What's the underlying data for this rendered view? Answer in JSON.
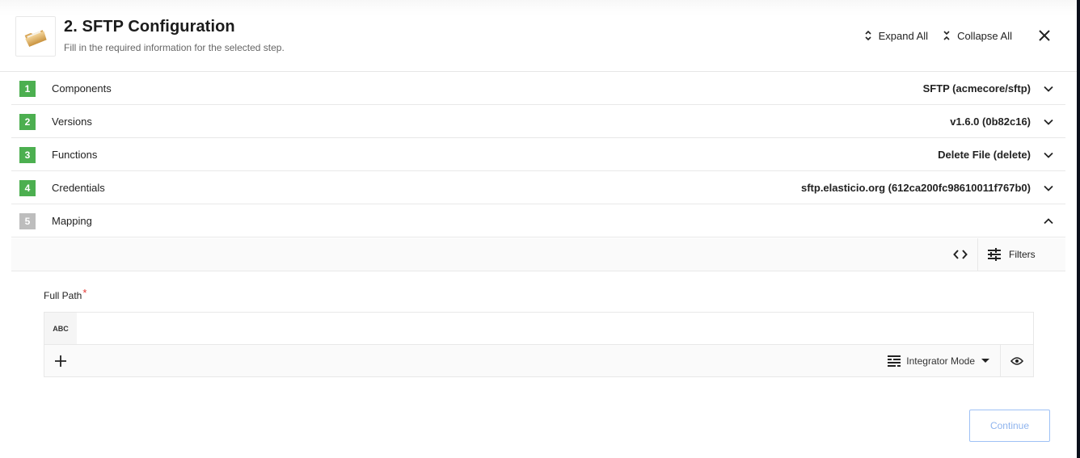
{
  "header": {
    "title": "2. SFTP Configuration",
    "subtitle": "Fill in the required information for the selected step.",
    "logo_icon": "folder-icon",
    "expand_all_label": "Expand All",
    "collapse_all_label": "Collapse All",
    "close_icon": "close-icon"
  },
  "steps": [
    {
      "number": "1",
      "label": "Components",
      "value": "SFTP (acmecore/sftp)",
      "status": "complete",
      "expanded": false
    },
    {
      "number": "2",
      "label": "Versions",
      "value": "v1.6.0 (0b82c16)",
      "status": "complete",
      "expanded": false
    },
    {
      "number": "3",
      "label": "Functions",
      "value": "Delete File (delete)",
      "status": "complete",
      "expanded": false
    },
    {
      "number": "4",
      "label": "Credentials",
      "value": "sftp.elasticio.org (612ca200fc98610011f767b0)",
      "status": "complete",
      "expanded": false
    },
    {
      "number": "5",
      "label": "Mapping",
      "value": "",
      "status": "pending",
      "expanded": true
    }
  ],
  "mapping": {
    "filters_label": "Filters",
    "field": {
      "label": "Full Path",
      "required_marker": "*",
      "type_badge": "ABC",
      "value": "",
      "placeholder": ""
    },
    "mode_label": "Integrator Mode"
  },
  "continue_label": "Continue",
  "colors": {
    "step_complete": "#4caf50",
    "step_pending": "#bdbdbd",
    "required": "#e53935",
    "continue_disabled": "#8fb4ee"
  }
}
